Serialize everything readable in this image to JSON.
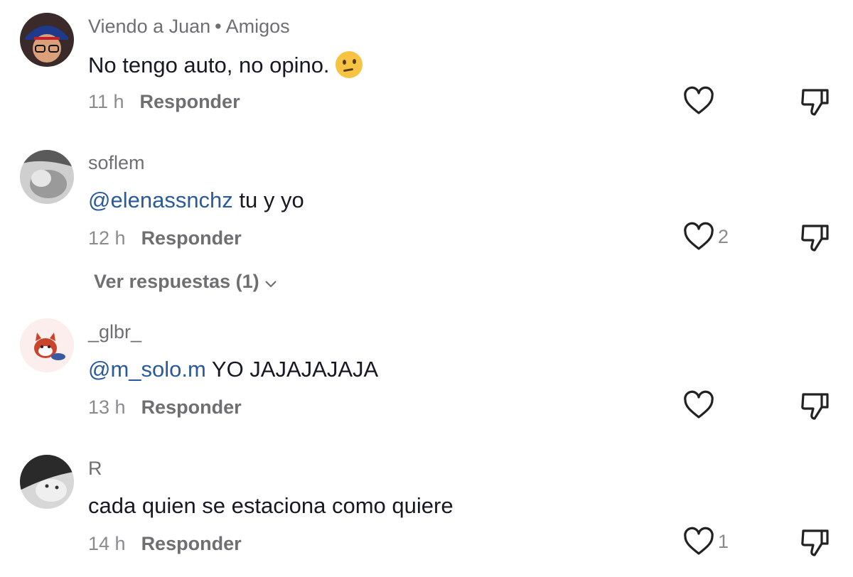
{
  "comments": [
    {
      "username": "Viendo a Juan",
      "badge": "Amigos",
      "mention": "",
      "text": "No tengo auto, no opino.",
      "emoji": "thinking-face",
      "time": "11 h",
      "reply_label": "Responder",
      "likes": ""
    },
    {
      "username": "soflem",
      "mention": "@elenassnchz",
      "text": " tu y yo",
      "time": "12 h",
      "reply_label": "Responder",
      "likes": "2",
      "view_replies": "Ver respuestas (1)"
    },
    {
      "username": "_glbr_",
      "mention": "@m_solo.m",
      "text": " YO JAJAJAJAJA",
      "time": "13 h",
      "reply_label": "Responder",
      "likes": ""
    },
    {
      "username": "R",
      "mention": "",
      "text": "cada quien se estaciona como quiere",
      "time": "14 h",
      "reply_label": "Responder",
      "likes": "1"
    }
  ],
  "icons": {
    "like": "heart-outline-icon",
    "dislike": "thumbs-down-outline-icon",
    "expand": "chevron-down-icon"
  },
  "colors": {
    "mention": "#2b5a9b",
    "secondary_text": "#8a8b91",
    "icon_stroke": "#222222"
  }
}
